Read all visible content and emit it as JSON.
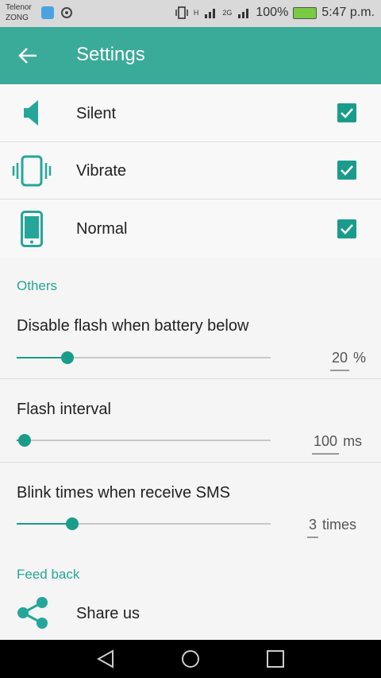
{
  "status": {
    "carrier1": "Telenor",
    "carrier2": "ZONG",
    "net_h": "H",
    "net_2g": "2G",
    "battery": "100%",
    "time": "5:47 p.m."
  },
  "appbar": {
    "title": "Settings",
    "back_icon": "arrow-left-icon"
  },
  "modes": [
    {
      "label": "Silent",
      "icon": "speaker-icon",
      "checked": true
    },
    {
      "label": "Vibrate",
      "icon": "vibrate-icon",
      "checked": true
    },
    {
      "label": "Normal",
      "icon": "phone-icon",
      "checked": true
    }
  ],
  "others": {
    "header": "Others",
    "battery": {
      "title": "Disable flash when battery below",
      "value": "20",
      "unit": "%",
      "level": 0.2
    },
    "interval": {
      "title": "Flash interval",
      "value": "100",
      "unit": "ms",
      "level": 0.03
    },
    "blink": {
      "title": "Blink times when receive SMS",
      "value": "3",
      "unit": "times",
      "level": 0.22
    }
  },
  "feedback": {
    "header": "Feed back",
    "share_label": "Share us",
    "share_icon": "share-icon"
  },
  "colors": {
    "accent": "#3aaa99",
    "control": "#1a9c8a",
    "section": "#26a69a"
  },
  "nav": {
    "back": "nav-back-icon",
    "home": "nav-home-icon",
    "recents": "nav-recents-icon"
  }
}
